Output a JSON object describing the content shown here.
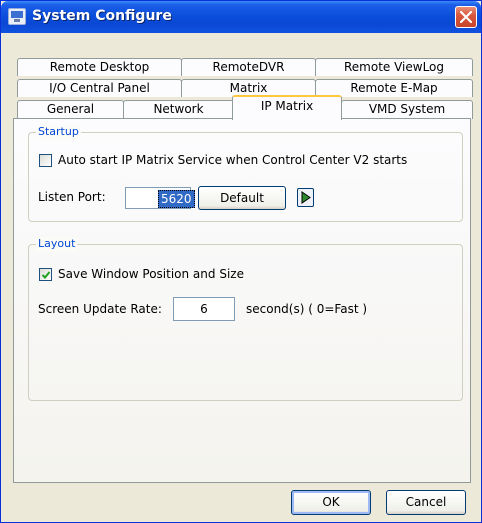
{
  "window": {
    "title": "System Configure"
  },
  "tabs": {
    "row1": [
      {
        "label": "Remote Desktop"
      },
      {
        "label": "RemoteDVR"
      },
      {
        "label": "Remote ViewLog"
      }
    ],
    "row2": [
      {
        "label": "I/O Central Panel"
      },
      {
        "label": "Matrix"
      },
      {
        "label": "Remote E-Map"
      }
    ],
    "row3": [
      {
        "label": "General"
      },
      {
        "label": "Network"
      },
      {
        "label": "IP Matrix"
      },
      {
        "label": "VMD System"
      }
    ],
    "active": "IP Matrix"
  },
  "startup": {
    "group_label": "Startup",
    "autostart_label": "Auto start IP Matrix Service when Control Center V2 starts",
    "autostart_checked": false,
    "listen_port_label": "Listen Port:",
    "listen_port_value": "5620",
    "default_button": "Default"
  },
  "layout": {
    "group_label": "Layout",
    "save_window_label": "Save Window Position and Size",
    "save_window_checked": true,
    "update_rate_label": "Screen Update Rate:",
    "update_rate_value": "6",
    "update_rate_unit": "second(s) ( 0=Fast )"
  },
  "buttons": {
    "ok": "OK",
    "cancel": "Cancel"
  },
  "colors": {
    "title_bar": "#0b4fdc",
    "group_label": "#0046d5",
    "active_tab_accent": "#ffc83c",
    "close_button": "#d9583e",
    "arrow_icon": "#2e8b2e"
  },
  "icons": {
    "app": "monitor-icon",
    "close": "close-icon",
    "arrow": "play-arrow-icon",
    "check": "checkmark-icon"
  }
}
